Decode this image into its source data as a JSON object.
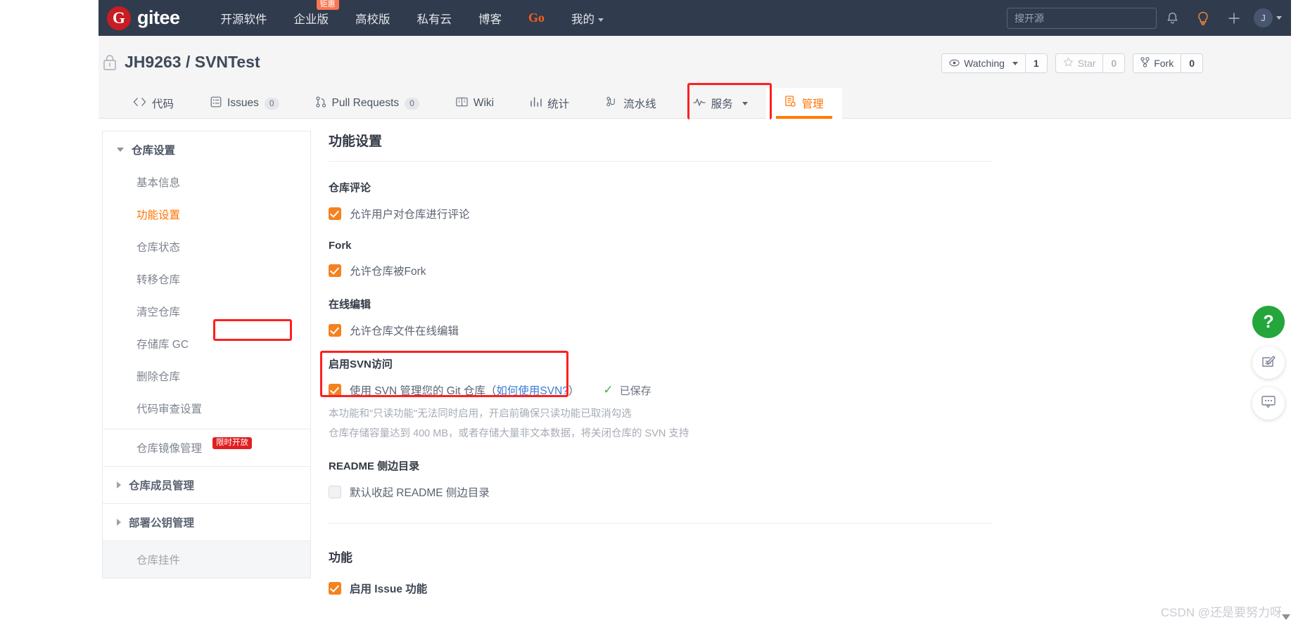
{
  "topnav": {
    "logo_letter": "G",
    "logo_text": "gitee",
    "links": [
      {
        "label": "开源软件",
        "badge": null,
        "kind": "normal"
      },
      {
        "label": "企业版",
        "badge": "钜惠",
        "kind": "normal"
      },
      {
        "label": "高校版",
        "badge": null,
        "kind": "normal"
      },
      {
        "label": "私有云",
        "badge": null,
        "kind": "normal"
      },
      {
        "label": "博客",
        "badge": null,
        "kind": "normal"
      },
      {
        "label": "Go",
        "badge": null,
        "kind": "go"
      },
      {
        "label": "我的",
        "badge": null,
        "kind": "dropdown"
      }
    ],
    "search_placeholder": "搜开源",
    "icons": [
      "bell-icon",
      "lightbulb-icon",
      "plus-icon"
    ],
    "avatar_letter": "J"
  },
  "repo": {
    "visibility_icon": "lock-icon",
    "owner": "JH9263",
    "separator": "/",
    "name": "SVNTest",
    "full_title": "JH9263 / SVNTest",
    "actions": [
      {
        "name": "watching",
        "label": "Watching",
        "count": "1",
        "icon": "eye-icon",
        "dropdown": true,
        "dim": false
      },
      {
        "name": "star",
        "label": "Star",
        "count": "0",
        "icon": "star-icon",
        "dropdown": false,
        "dim": true
      },
      {
        "name": "fork",
        "label": "Fork",
        "count": "0",
        "icon": "fork-icon",
        "dropdown": false,
        "dim": false
      }
    ],
    "tabs": [
      {
        "label": "代码",
        "icon": "code-icon",
        "count": null,
        "active": false,
        "dropdown": false
      },
      {
        "label": "Issues",
        "icon": "issues-icon",
        "count": "0",
        "active": false,
        "dropdown": false
      },
      {
        "label": "Pull Requests",
        "icon": "pull-request-icon",
        "count": "0",
        "active": false,
        "dropdown": false
      },
      {
        "label": "Wiki",
        "icon": "wiki-icon",
        "count": null,
        "active": false,
        "dropdown": false
      },
      {
        "label": "统计",
        "icon": "stats-icon",
        "count": null,
        "active": false,
        "dropdown": false
      },
      {
        "label": "流水线",
        "icon": "pipeline-icon",
        "count": null,
        "active": false,
        "dropdown": false
      },
      {
        "label": "服务",
        "icon": "service-icon",
        "count": null,
        "active": false,
        "dropdown": true
      },
      {
        "label": "管理",
        "icon": "manage-icon",
        "count": null,
        "active": true,
        "dropdown": false
      }
    ]
  },
  "sidebar": {
    "group_label": "仓库设置",
    "items": [
      {
        "label": "基本信息",
        "active": false
      },
      {
        "label": "功能设置",
        "active": true
      },
      {
        "label": "仓库状态",
        "active": false
      },
      {
        "label": "转移仓库",
        "active": false
      },
      {
        "label": "清空仓库",
        "active": false
      },
      {
        "label": "存储库 GC",
        "active": false
      },
      {
        "label": "删除仓库",
        "active": false
      },
      {
        "label": "代码审查设置",
        "active": false
      }
    ],
    "sections": [
      {
        "label": "仓库镜像管理",
        "badge": "限时开放",
        "expandable": false
      },
      {
        "label": "仓库成员管理",
        "badge": null,
        "expandable": true
      },
      {
        "label": "部署公钥管理",
        "badge": null,
        "expandable": true
      }
    ],
    "footer_item": {
      "label": "仓库挂件"
    }
  },
  "main": {
    "title": "功能设置",
    "sections": [
      {
        "heading": "仓库评论",
        "checkbox": {
          "label": "允许用户对仓库进行评论",
          "checked": true
        }
      },
      {
        "heading": "Fork",
        "checkbox": {
          "label": "允许仓库被Fork",
          "checked": true
        }
      },
      {
        "heading": "在线编辑",
        "checkbox": {
          "label": "允许仓库文件在线编辑",
          "checked": true
        }
      }
    ],
    "svn": {
      "heading": "启用SVN访问",
      "checked": true,
      "label_prefix": "使用 SVN 管理您的 Git 仓库（",
      "link_text": "如何使用SVN?",
      "label_suffix": "）",
      "saved_text": "已保存",
      "saved_icon": "check-icon",
      "hint1": "本功能和\"只读功能\"无法同时启用，开启前确保只读功能已取消勾选",
      "hint2": "仓库存储容量达到 400 MB，或者存储大量非文本数据，将关闭仓库的 SVN 支持"
    },
    "readme": {
      "heading": "README 侧边目录",
      "checkbox": {
        "label": "默认收起 README 侧边目录",
        "checked": false
      }
    },
    "features": {
      "heading": "功能",
      "checkbox": {
        "label": "启用 Issue 功能",
        "checked": true
      }
    }
  },
  "fabs": [
    {
      "name": "help-fab",
      "glyph": "?",
      "style": "green"
    },
    {
      "name": "feedback-edit-fab",
      "glyph": "edit-icon",
      "style": "white"
    },
    {
      "name": "chat-fab",
      "glyph": "chat-icon",
      "style": "white"
    }
  ],
  "watermark": "CSDN @还是要努力呀",
  "colors": {
    "brand_orange": "#ff7300",
    "logo_red": "#c71d23",
    "nav_bg": "#303b4d",
    "annotation_red": "#ff1f1f",
    "checkbox_on": "#f5811f",
    "saved_green": "#3ab54a"
  }
}
